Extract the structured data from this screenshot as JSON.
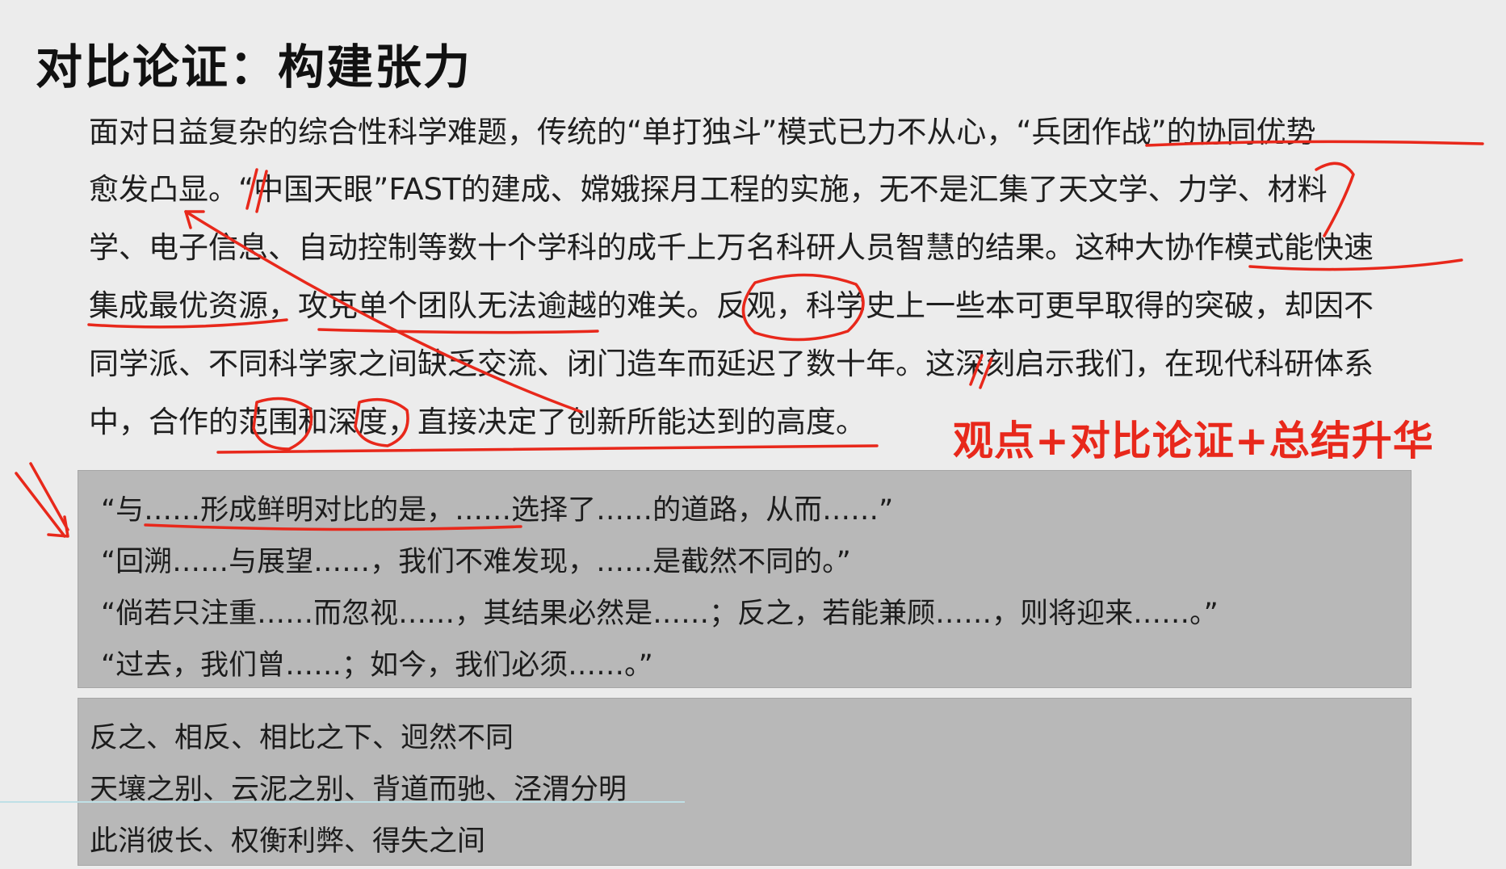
{
  "title": "对比论证：构建张力",
  "paragraph_lines": [
    "面对日益复杂的综合性科学难题，传统的“单打独斗”模式已力不从心，“兵团作战”的协同优势",
    "愈发凸显。“中国天眼”FAST的建成、嫦娥探月工程的实施，无不是汇集了天文学、力学、材料",
    "学、电子信息、自动控制等数十个学科的成千上万名科研人员智慧的结果。这种大协作模式能快速",
    "集成最优资源，攻克单个团队无法逾越的难关。反观，科学史上一些本可更早取得的突破，却因不",
    "同学派、不同科学家之间缺乏交流、闭门造车而延迟了数十年。这深刻启示我们，在现代科研体系",
    "中，合作的范围和深度，直接决定了创新所能达到的高度。"
  ],
  "annotation_note": "观点+对比论证+总结升华",
  "sentence_patterns": [
    "“与……形成鲜明对比的是，……选择了……的道路，从而……”",
    "“回溯……与展望……，我们不难发现，……是截然不同的。”",
    "“倘若只注重……而忽视……，其结果必然是……；反之，若能兼顾……，则将迎来……。”",
    "“过去，我们曾……；如今，我们必须……。”"
  ],
  "contrast_words": [
    "反之、相反、相比之下、迥然不同",
    "天壤之别、云泥之别、背道而驰、泾渭分明",
    "此消彼长、权衡利弊、得失之间"
  ],
  "colors": {
    "annotation": "#e8281b",
    "box_background": "#b8b8b8",
    "page_background": "#ececec"
  }
}
